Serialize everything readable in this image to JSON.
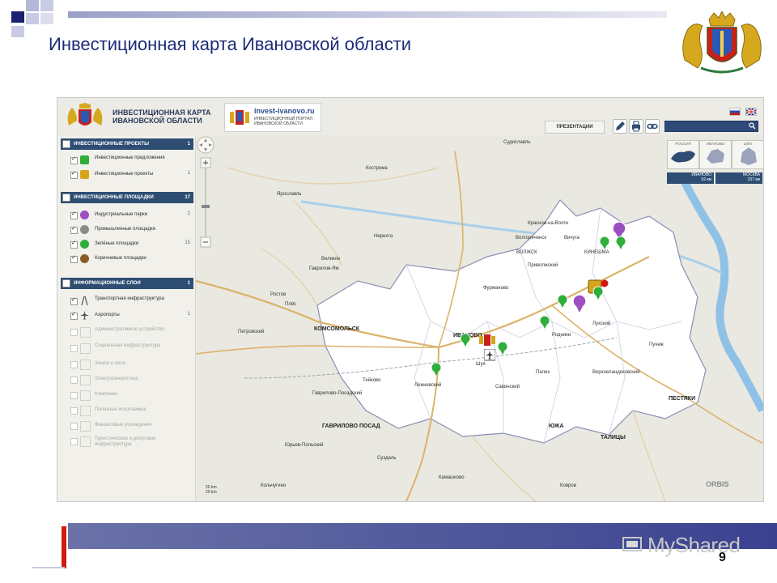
{
  "slide": {
    "title": "Инвестиционная карта Ивановской области",
    "page_number": "9",
    "watermark": "MyShared"
  },
  "app": {
    "title_line1": "ИНВЕСТИЦИОННАЯ КАРТА",
    "title_line2": "ИВАНОВСКОЙ ОБЛАСТИ",
    "portal_name": "invest-ivanovo.ru",
    "portal_sub": "ИНВЕСТИЦИОННЫЙ ПОРТАЛ ИВАНОВСКОЙ ОБЛАСТИ",
    "presentations_label": "ПРЕЗЕНТАЦИИ"
  },
  "sidebar": {
    "sections": [
      {
        "label": "ИНВЕСТИЦИОННЫЕ ПРОЕКТЫ",
        "count": "1",
        "items": [
          {
            "label": "Инвестиционные предложения",
            "count": "",
            "color": "#2fae3c",
            "shape": "square"
          },
          {
            "label": "Инвестиционные проекты",
            "count": "1",
            "color": "#d7a51c",
            "shape": "square"
          }
        ]
      },
      {
        "label": "ИНВЕСТИЦИОННЫЕ ПЛОЩАДКИ",
        "count": "17",
        "items": [
          {
            "label": "Индустриальные парки",
            "count": "2",
            "color": "#9b4fc0",
            "shape": "circle"
          },
          {
            "label": "Промышленные площадки",
            "count": "",
            "color": "#8a8a8a",
            "shape": "circle"
          },
          {
            "label": "Зелёные площадки",
            "count": "15",
            "color": "#2fae3c",
            "shape": "circle"
          },
          {
            "label": "Коричневые площадки",
            "count": "",
            "color": "#8b5a2b",
            "shape": "circle"
          }
        ]
      },
      {
        "label": "ИНФОРМАЦИОННЫЕ СЛОИ",
        "count": "1",
        "items": [
          {
            "label": "Транспортная инфраструктура",
            "count": ""
          },
          {
            "label": "Аэропорты",
            "count": "1"
          },
          {
            "label": "Административное устройство",
            "count": ""
          },
          {
            "label": "Социальная инфраструктура",
            "count": ""
          },
          {
            "label": "Земли и леса",
            "count": ""
          },
          {
            "label": "Электроэнергетика",
            "count": ""
          },
          {
            "label": "Компании",
            "count": ""
          },
          {
            "label": "Полезные ископаемые",
            "count": ""
          },
          {
            "label": "Финансовые учреждения",
            "count": ""
          },
          {
            "label": "Туристическая и досуговая инфраструктура",
            "count": ""
          }
        ]
      }
    ]
  },
  "map": {
    "cities": {
      "ivanovo": "ИВАНОВО",
      "komsomolsk": "КОМСОМОЛЬСК",
      "gavrilovo": "ГАВРИЛОВО ПОСАД",
      "yuzha": "ЮЖА",
      "taltsy": "ТАЛИЦЫ",
      "pestyaki": "ПЕСТЯКИ",
      "kostroma": "Кострома",
      "yaroslavl": "Ярославль",
      "nerekhta": "Нерехта",
      "suzdal": "Суздаль",
      "kineshma": "КИНЕШМА",
      "plyos": "Плёс",
      "shuya": "Шуя",
      "rodniki": "Родники",
      "palekh": "Палех",
      "lukh": "Лухский",
      "teykovo": "Тейково",
      "sudislavl": "Судиславль",
      "kamashkovo": "Камашково",
      "rostov": "Ростов",
      "petrovsky": "Петровский",
      "gavrilov_yam": "Гаврилов-Ям",
      "yuryev": "Юрьев-Польский",
      "velikoe": "Великое",
      "vichuga": "Вичуга",
      "puchezh": "Пучеж",
      "furmanov": "Фурманово",
      "privolzhsk": "Приволжский",
      "zavolzhsk": "ВОЛЖСК",
      "krasnoe": "Красное-на-Волге",
      "volgorechensk": "Волгореченск",
      "kolchugino": "Кольчугино",
      "verhnelandeh": "Верхнеландеховский",
      "savino": "Савинский",
      "lezhnevo": "Лежневский",
      "kovrov": "Ковров",
      "gavrilovo_posad": "Гаврилово-Посадский"
    },
    "region_views": [
      "РОССИЯ",
      "ИВАНОВО",
      "ЦФО"
    ],
    "distances": [
      {
        "city": "ИВАНОВО",
        "value": "92 км"
      },
      {
        "city": "МОСКВА",
        "value": "337 км"
      }
    ],
    "brand": "ORBIS",
    "scale_a": "20 km",
    "scale_b": "20 km"
  },
  "colors": {
    "accent_dark": "#2d4d73",
    "green_pin": "#2fae3c",
    "purple_pin": "#9b4fc0",
    "gold_pin": "#d7a51c",
    "slide_title": "#1c2a78"
  },
  "icons": {
    "search": "search-icon",
    "edit": "pencil-icon",
    "print": "print-icon",
    "link": "link-icon",
    "pan": "pan-icon"
  }
}
